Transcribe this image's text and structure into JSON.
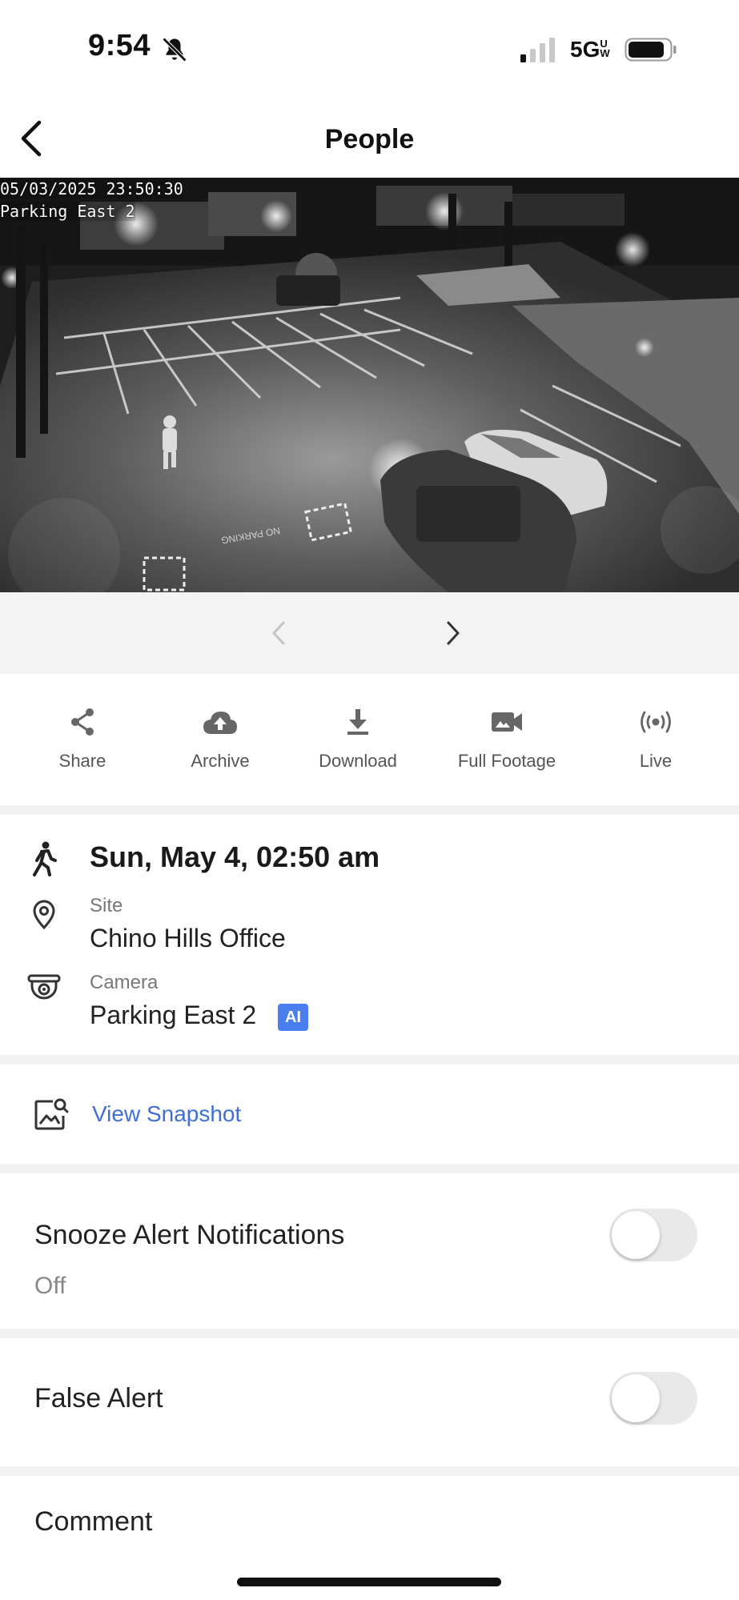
{
  "status_bar": {
    "time": "9:54",
    "network": "5GUW",
    "network_main": "5G",
    "network_sup": "UW",
    "signal_bars_active": 1,
    "signal_bars_total": 4,
    "battery_level": 0.85,
    "silent_icon": "bell-slash-icon"
  },
  "nav": {
    "title": "People",
    "back_icon": "chevron-left-icon"
  },
  "video": {
    "timestamp": "05/03/2025 23:50:30",
    "camera_name": "Parking East 2",
    "ground_text": "NO PARKING"
  },
  "pager": {
    "prev_icon": "chevron-left-icon",
    "next_icon": "chevron-right-icon",
    "prev_enabled": false,
    "next_enabled": true
  },
  "actions": [
    {
      "label": "Share",
      "icon": "share-icon"
    },
    {
      "label": "Archive",
      "icon": "cloud-upload-icon"
    },
    {
      "label": "Download",
      "icon": "download-icon"
    },
    {
      "label": "Full Footage",
      "icon": "video-camera-icon"
    },
    {
      "label": "Live",
      "icon": "broadcast-icon"
    }
  ],
  "details": {
    "event_time": "Sun, May 4, 02:50 am",
    "event_icon": "walking-person-icon",
    "site_label": "Site",
    "site_value": "Chino Hills Office",
    "site_icon": "location-pin-icon",
    "camera_label": "Camera",
    "camera_value": "Parking East 2",
    "camera_icon": "dome-camera-icon",
    "ai_badge": "AI"
  },
  "snapshot": {
    "link": "View Snapshot",
    "icon": "image-search-icon"
  },
  "snooze": {
    "title": "Snooze Alert Notifications",
    "status": "Off",
    "enabled": false
  },
  "false_alert": {
    "title": "False Alert",
    "enabled": false
  },
  "comment": {
    "title": "Comment"
  },
  "colors": {
    "link": "#3f6fd6",
    "ai_badge": "#4a7ef0",
    "separator": "#f2f2f2",
    "toggle_off": "#e9e9ea"
  }
}
